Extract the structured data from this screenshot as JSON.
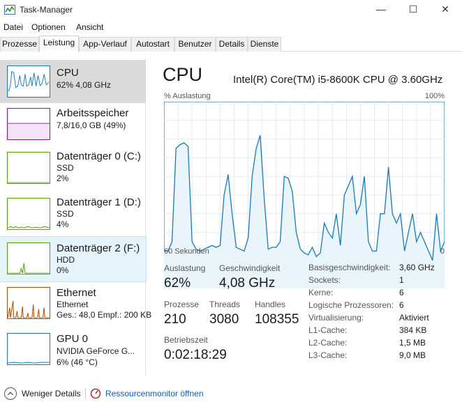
{
  "window": {
    "title": "Task-Manager",
    "minimize": "—",
    "maximize": "☐",
    "close": "✕"
  },
  "menu": [
    "Datei",
    "Optionen",
    "Ansicht"
  ],
  "tabs": [
    "Prozesse",
    "Leistung",
    "App-Verlauf",
    "Autostart",
    "Benutzer",
    "Details",
    "Dienste"
  ],
  "active_tab": "Leistung",
  "colors": {
    "cpu": "#1a79b8",
    "memory": "#8b12ae",
    "disk": "#4da60c",
    "ethernet": "#a74f01",
    "gpu": "#1a79b8",
    "graph_fill": "#eaf4fb",
    "grid": "#dbe9f3"
  },
  "sidebar": [
    {
      "title": "CPU",
      "sub1": "62% 4,08 GHz",
      "sub2": "",
      "sub3": ""
    },
    {
      "title": "Arbeitsspeicher",
      "sub1": "7,8/16,0 GB (49%)",
      "sub2": "",
      "sub3": ""
    },
    {
      "title": "Datenträger 0 (C:)",
      "sub1": "SSD",
      "sub2": "2%",
      "sub3": ""
    },
    {
      "title": "Datenträger 1 (D:)",
      "sub1": "SSD",
      "sub2": "4%",
      "sub3": ""
    },
    {
      "title": "Datenträger 2 (F:)",
      "sub1": "HDD",
      "sub2": "0%",
      "sub3": ""
    },
    {
      "title": "Ethernet",
      "sub1": "Ethernet",
      "sub2": "Ges.: 48,0 Empf.: 200 KB",
      "sub3": ""
    },
    {
      "title": "GPU 0",
      "sub1": "NVIDIA GeForce G...",
      "sub2": "6% (46 °C)",
      "sub3": ""
    }
  ],
  "main": {
    "title": "CPU",
    "model": "Intel(R) Core(TM) i5-8600K CPU @ 3.60GHz",
    "graph_top_left": "% Auslastung",
    "graph_top_right": "100%",
    "graph_bottom_left": "60 Sekunden",
    "graph_bottom_right": "0",
    "cpu_history": [
      20,
      20,
      25,
      75,
      77,
      78,
      76,
      25,
      21,
      20,
      21,
      22,
      23,
      22,
      23,
      50,
      61,
      40,
      22,
      21,
      20,
      27,
      60,
      75,
      82,
      48,
      21,
      22,
      22,
      25,
      60,
      59,
      52,
      30,
      21,
      19,
      18,
      22,
      17,
      19,
      35,
      30,
      27,
      40,
      23,
      50,
      55,
      60,
      40,
      45,
      60,
      25,
      20,
      20,
      40,
      40,
      65,
      40,
      35,
      40,
      20,
      30,
      40,
      25,
      30,
      25,
      20,
      15,
      40,
      20,
      25
    ],
    "stats": {
      "auslastung_label": "Auslastung",
      "auslastung_value": "62%",
      "geschwindigkeit_label": "Geschwindigkeit",
      "geschwindigkeit_value": "4,08 GHz",
      "prozesse_label": "Prozesse",
      "prozesse_value": "210",
      "threads_label": "Threads",
      "threads_value": "3080",
      "handles_label": "Handles",
      "handles_value": "108355",
      "betriebszeit_label": "Betriebszeit",
      "betriebszeit_value": "0:02:18:29"
    },
    "specs": [
      {
        "key": "Basisgeschwindigkeit:",
        "value": "3,60 GHz"
      },
      {
        "key": "Sockets:",
        "value": "1"
      },
      {
        "key": "Kerne:",
        "value": "6"
      },
      {
        "key": "Logische Prozessoren:",
        "value": "6"
      },
      {
        "key": "Virtualisierung:",
        "value": "Aktiviert"
      },
      {
        "key": "L1-Cache:",
        "value": "384 KB"
      },
      {
        "key": "L2-Cache:",
        "value": "1,5 MB"
      },
      {
        "key": "L3-Cache:",
        "value": "9,0 MB"
      }
    ]
  },
  "footer": {
    "fewer_details": "Weniger Details",
    "resource_monitor": "Ressourcenmonitor öffnen"
  }
}
